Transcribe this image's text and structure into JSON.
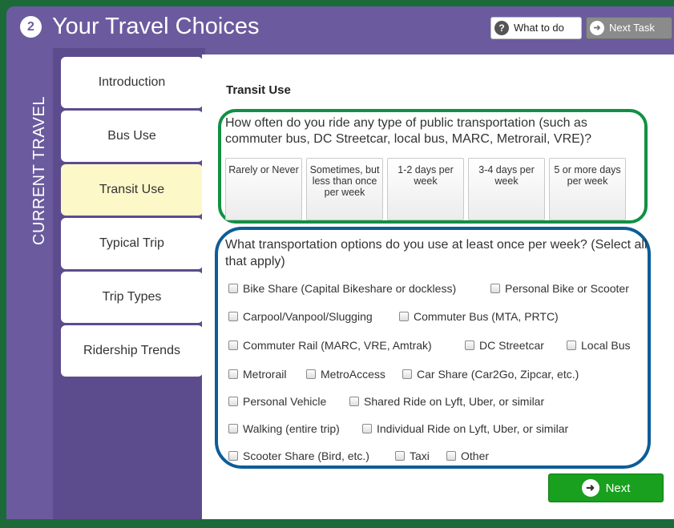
{
  "header": {
    "step_number": "2",
    "title": "Your Travel Choices",
    "what_to_do": "What to do",
    "next_task": "Next Task"
  },
  "sidebar_section": "CURRENT TRAVEL",
  "nav": {
    "items": [
      {
        "label": "Introduction"
      },
      {
        "label": "Bus Use"
      },
      {
        "label": "Transit Use"
      },
      {
        "label": "Typical Trip"
      },
      {
        "label": "Trip Types"
      },
      {
        "label": "Ridership Trends"
      }
    ],
    "active": "Transit Use"
  },
  "content": {
    "section_title": "Transit Use",
    "q1": {
      "text": "How often do you ride any type of public transportation (such as commuter bus, DC Streetcar, local bus, MARC, Metrorail, VRE)?",
      "options": [
        {
          "label": "Rarely or Never"
        },
        {
          "label": "Sometimes, but less than once per week"
        },
        {
          "label": "1-2 days per week"
        },
        {
          "label": "3-4 days per week"
        },
        {
          "label": "5 or more days per week"
        }
      ]
    },
    "q2": {
      "text": "What transportation options do you use at least once per week? (Select all that apply)",
      "options": [
        {
          "label": "Bike Share (Capital Bikeshare or dockless)"
        },
        {
          "label": "Personal Bike or Scooter"
        },
        {
          "label": "Carpool/Vanpool/Slugging"
        },
        {
          "label": "Commuter Bus (MTA, PRTC)"
        },
        {
          "label": "Commuter Rail (MARC, VRE, Amtrak)"
        },
        {
          "label": "DC Streetcar"
        },
        {
          "label": "Local Bus"
        },
        {
          "label": "Metrorail"
        },
        {
          "label": "MetroAccess"
        },
        {
          "label": "Car Share (Car2Go, Zipcar, etc.)"
        },
        {
          "label": "Personal Vehicle"
        },
        {
          "label": "Shared Ride on Lyft, Uber, or similar"
        },
        {
          "label": "Walking (entire trip)"
        },
        {
          "label": "Individual Ride on Lyft, Uber, or similar"
        },
        {
          "label": "Scooter Share (Bird, etc.)"
        },
        {
          "label": "Taxi"
        },
        {
          "label": "Other"
        }
      ]
    },
    "next_label": "Next"
  },
  "colors": {
    "purple": "#6b5b9e",
    "green_outline": "#119043",
    "blue_outline": "#0c5d98",
    "next_green": "#18a01e",
    "active_nav": "#fdf8c8"
  }
}
